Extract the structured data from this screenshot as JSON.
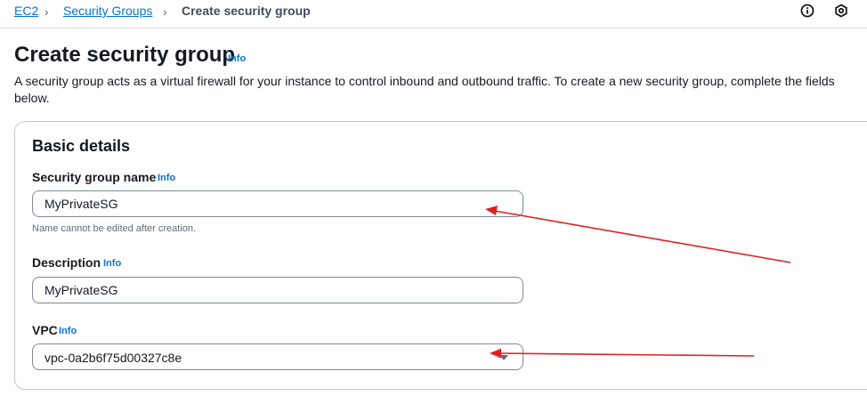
{
  "breadcrumb": {
    "items": [
      "EC2",
      "Security Groups"
    ],
    "current": "Create security group"
  },
  "header": {
    "title": "Create security group",
    "info": "Info",
    "description": "A security group acts as a virtual firewall for your instance to control inbound and outbound traffic. To create a new security group, complete the fields below."
  },
  "basic_details": {
    "title": "Basic details",
    "name": {
      "label": "Security group name",
      "info": "Info",
      "value": "MyPrivateSG",
      "hint": "Name cannot be edited after creation."
    },
    "description": {
      "label": "Description",
      "info": "Info",
      "value": "MyPrivateSG"
    },
    "vpc": {
      "label": "VPC",
      "info": "Info",
      "value": "vpc-0a2b6f75d00327c8e"
    }
  },
  "icons": {
    "top_right": [
      "info-circle-icon",
      "settings-hex-icon"
    ]
  },
  "colors": {
    "link": "#0972d3",
    "annotation": "#e02020"
  }
}
